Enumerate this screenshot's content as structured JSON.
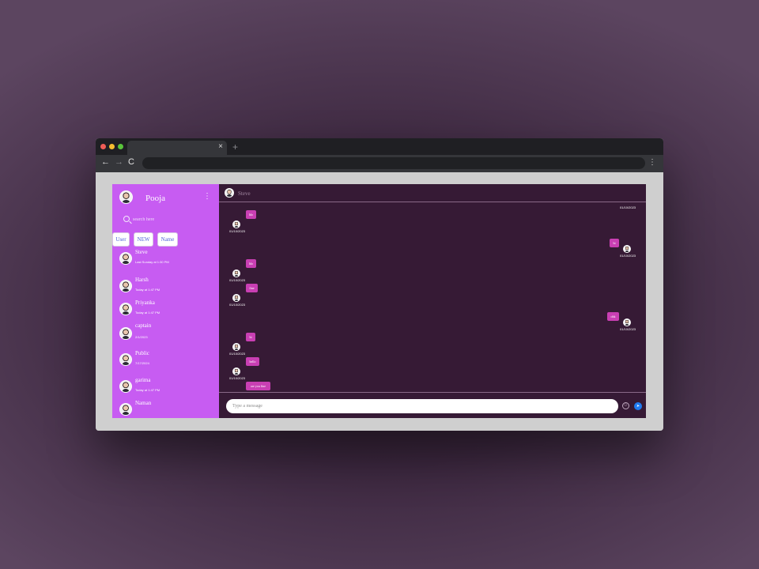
{
  "browser": {
    "tab_close": "×",
    "new_tab": "+",
    "back": "←",
    "forward": "→",
    "reload": "C",
    "menu": "⋮"
  },
  "user": {
    "name": "Pooja",
    "menu": "⋮"
  },
  "search": {
    "placeholder": "search here"
  },
  "filters": [
    "User",
    "NEW",
    "Name"
  ],
  "contacts": [
    {
      "name": "Steve",
      "message": "",
      "time": "Last Sunday at 1:30 PM"
    },
    {
      "name": "Harsh",
      "message": "",
      "time": "Today at 1:47 PM"
    },
    {
      "name": "Priyanka",
      "message": "",
      "time": "Today at 1:47 PM"
    },
    {
      "name": "captain",
      "message": "",
      "time": "2/1/2023"
    },
    {
      "name": "Public",
      "message": "",
      "time": "7/17/2024"
    },
    {
      "name": "garima",
      "message": "",
      "time": "Today at 1:47 PM"
    },
    {
      "name": "Naman",
      "message": "",
      "time": ""
    }
  ],
  "chat": {
    "title": "Steve",
    "top_time": "01/10/2023",
    "messages": [
      {
        "side": "left",
        "text": "hlo",
        "time": "01/10/2023"
      },
      {
        "side": "right",
        "text": "hi",
        "time": "01/10/2023"
      },
      {
        "side": "left",
        "text": "hlo",
        "time": "01/10/2023"
      },
      {
        "side": "left",
        "text": "fine",
        "time": "01/10/2023"
      },
      {
        "side": "right",
        "text": "ohk",
        "time": "01/10/2023"
      },
      {
        "side": "left",
        "text": "hi",
        "time": "01/10/2023"
      },
      {
        "side": "left",
        "text": "hello",
        "time": "01/10/2023"
      },
      {
        "side": "left",
        "text": "are you fine",
        "time": ""
      }
    ]
  },
  "composer": {
    "placeholder": "Type a message",
    "emoji": "☺",
    "send": "➤"
  },
  "colors": {
    "sidebar": "#c75cf2",
    "chat_bg": "#361a35",
    "bubble": "#c93fb3",
    "send": "#1f7bf2"
  }
}
